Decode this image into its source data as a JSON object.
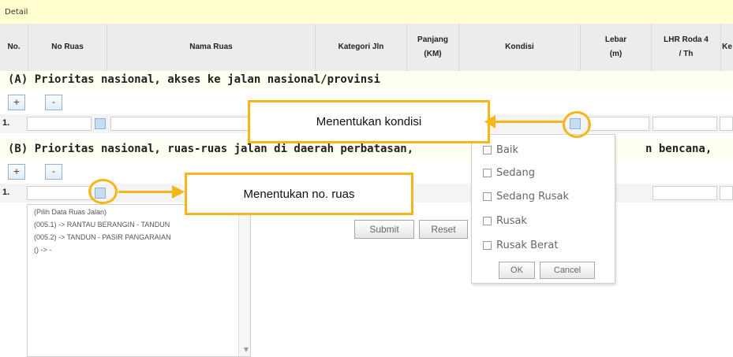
{
  "detail": {
    "label": "Detail"
  },
  "table_header": {
    "columns": [
      "No.",
      "No Ruas",
      "Nama Ruas",
      "Kategori Jln",
      "Panjang\n(KM)",
      "Kondisi",
      "Lebar\n(m)",
      "LHR Roda 4\n/ Th",
      "Ke"
    ]
  },
  "section_a": {
    "title": "(A) Prioritas nasional, akses ke jalan nasional/provinsi",
    "add_label": "+",
    "remove_label": "-",
    "row_number": "1."
  },
  "section_b": {
    "title_left": "(B) Prioritas nasional, ruas-ruas jalan di daerah perbatasan,",
    "title_right": "n bencana,",
    "add_label": "+",
    "remove_label": "-",
    "row_number": "1."
  },
  "ruas_list": {
    "options": [
      "(Pilih Data Ruas Jalan)",
      "(005.1) -> RANTAU BERANGIN - TANDUN",
      "(005.2) -> TANDUN - PASIR PANGARAIAN",
      "() -> -"
    ]
  },
  "form": {
    "submit_label": "Submit",
    "reset_label": "Reset"
  },
  "kondisi_popup": {
    "options": [
      "Baik",
      "Sedang",
      "Sedang Rusak",
      "Rusak",
      "Rusak Berat"
    ],
    "ok_label": "OK",
    "cancel_label": "Cancel"
  },
  "callouts": {
    "kondisi": "Menentukan kondisi",
    "no_ruas": "Menentukan no. ruas"
  },
  "colors": {
    "callout": "#f4b619",
    "detail_bg": "#ffffd0",
    "header_bg": "#ececec"
  }
}
